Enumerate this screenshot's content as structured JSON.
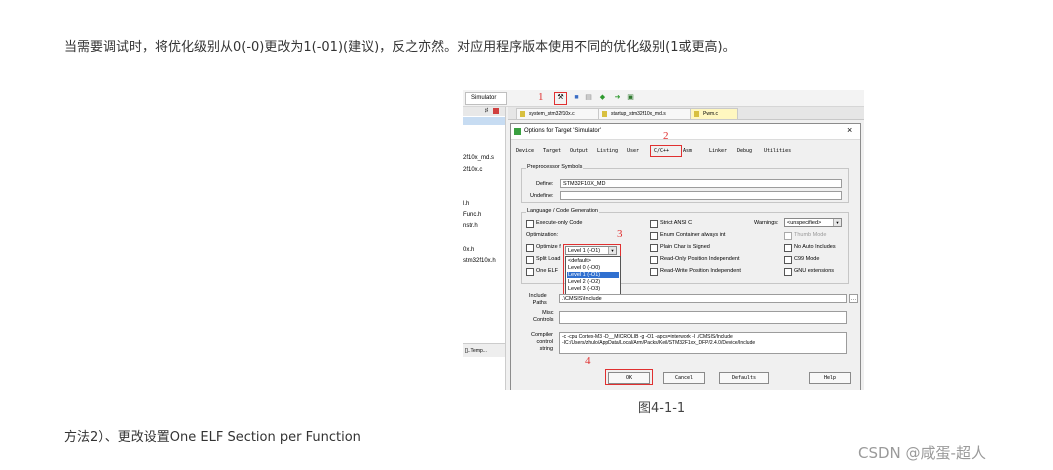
{
  "article": {
    "para1": "当需要调试时，将优化级别从0(-0)更改为1(-01)(建议)，反之亦然。对应用程序版本使用不同的优化级别(1或更高)。",
    "caption": "图4-1-1",
    "para2": "方法2）、更改设置One ELF Section per Function",
    "watermark": "CSDN @咸蛋-超人"
  },
  "screenshot": {
    "toolbar": {
      "target": "Simulator"
    },
    "annotations": [
      "1",
      "2",
      "3",
      "4"
    ],
    "left_pane": {
      "pin": "♯",
      "items": [
        "2f10x_md.s",
        "2f10x.c",
        "l.h",
        "Func.h",
        "nstr.h",
        "0x.h",
        "stm32f10x.h"
      ],
      "bottom_tab": "[]..Temp..."
    },
    "file_tabs": [
      "system_stm32f10x.c",
      "startup_stm32f10x_md.s",
      "Pwm.c"
    ],
    "dialog": {
      "title": "Options for Target 'Simulator'",
      "close": "×",
      "tabs": [
        "Device",
        "Target",
        "Output",
        "Listing",
        "User",
        "C/C++",
        "Asm",
        "Linker",
        "Debug",
        "Utilities"
      ],
      "preprocessor": {
        "group": "Preprocessor Symbols",
        "define_label": "Define:",
        "define_value": "STM32F10X_MD",
        "undefine_label": "Undefine:"
      },
      "language": {
        "group": "Language / Code Generation",
        "execute_only": "Execute-only Code",
        "optimization_label": "Optimization:",
        "optimization_value": "Level 1 (-O1)",
        "optimize_partial": "Optimize f",
        "split_partial": "Split Load",
        "one_elf_partial": "One ELF",
        "dropdown_options": [
          "<default>",
          "Level 0 (-O0)",
          "Level 1 (-O1)",
          "Level 2 (-O2)",
          "Level 3 (-O3)"
        ],
        "strict_ansi": "Strict ANSI C",
        "enum_container": "Enum Container always int",
        "plain_char": "Plain Char is Signed",
        "ro_pos": "Read-Only Position Independent",
        "rw_pos": "Read-Write Position Independent",
        "warnings_label": "Warnings:",
        "warnings_value": "<unspecified>",
        "thumb_mode": "Thumb Mode",
        "no_auto": "No Auto Includes",
        "c99": "C99 Mode",
        "gnu": "GNU extensions"
      },
      "include_label": "Include\nPaths",
      "include_value": ".\\CMSIS\\Include",
      "misc_label": "Misc\nControls",
      "compiler_label": "Compiler\ncontrol\nstring",
      "compiler_line1": "-c -cpu Cortex-M3 -D__MICROLIB -g -O1 -apcs=interwork -I ./CMSIS/Include",
      "compiler_line2": "-IC:/Users/zhulo/AppData/Local/Arm/Packs/Keil/STM32F1xx_DFP/2.4.0/Device/Include",
      "buttons": {
        "ok": "OK",
        "cancel": "Cancel",
        "defaults": "Defaults",
        "help": "Help"
      }
    }
  }
}
